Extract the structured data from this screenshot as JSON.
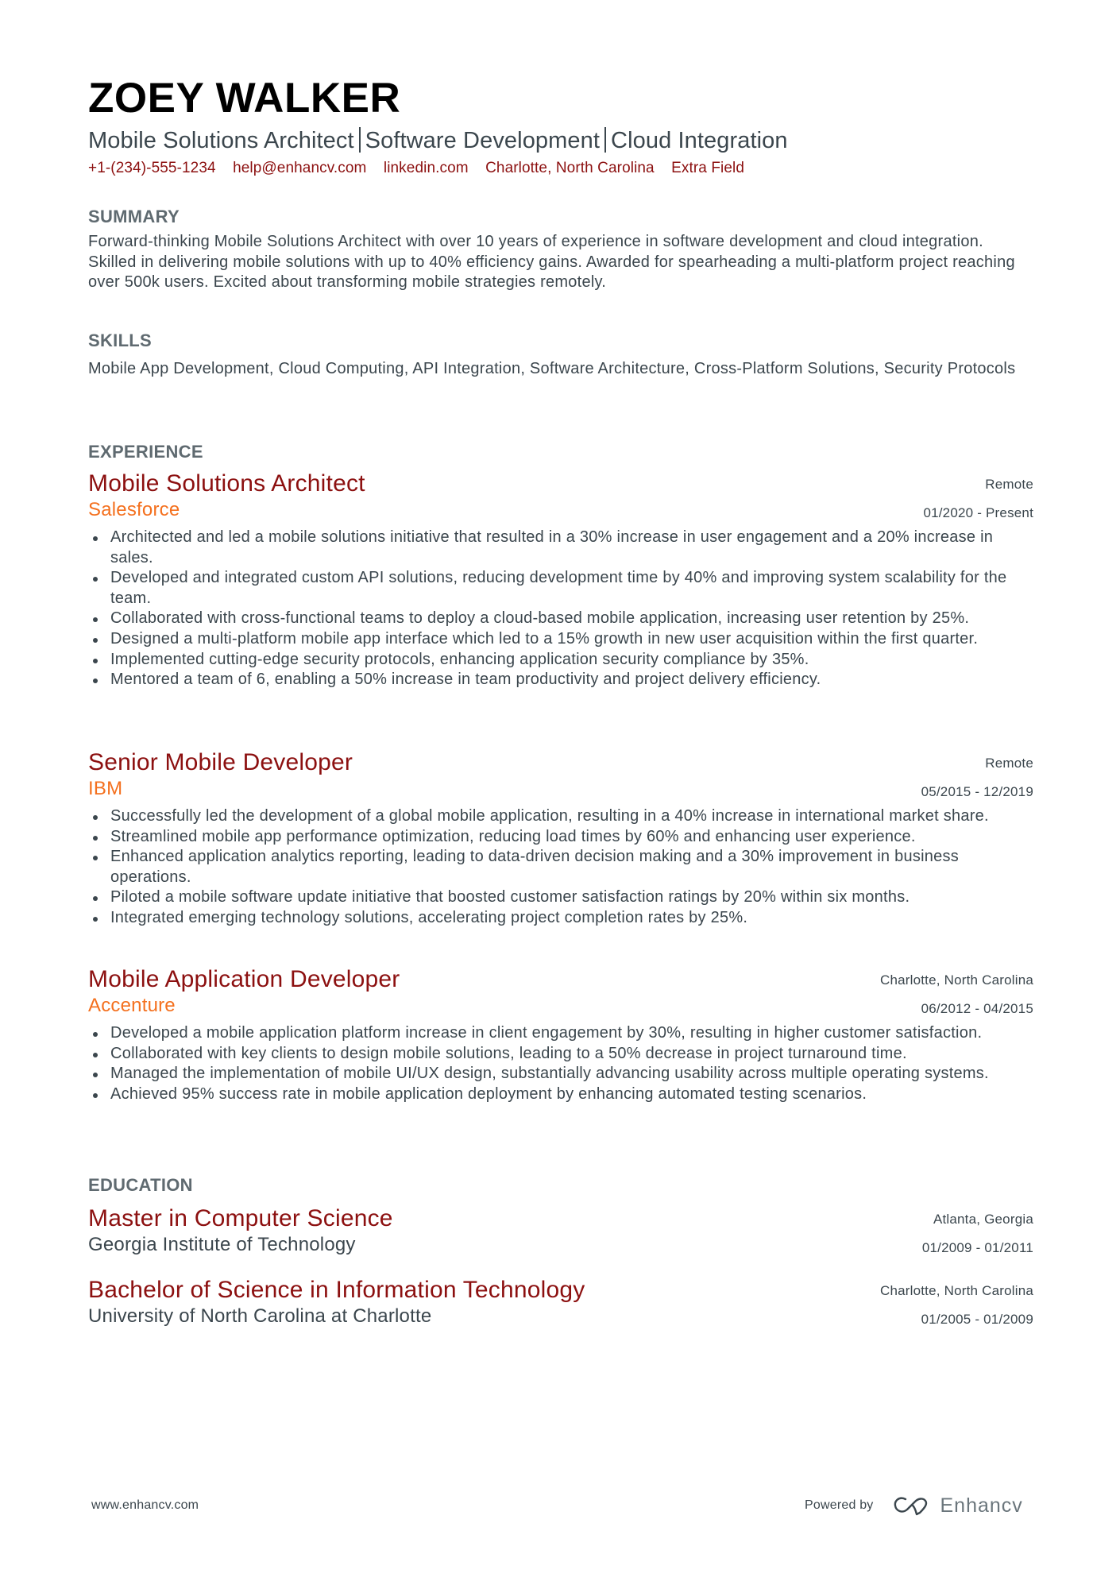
{
  "header": {
    "name": "ZOEY WALKER",
    "title_parts": [
      "Mobile Solutions Architect",
      "Software Development",
      "Cloud Integration"
    ],
    "contact": {
      "phone": "+1-(234)-555-1234",
      "email": "help@enhancv.com",
      "linkedin": "linkedin.com",
      "location": "Charlotte, North Carolina",
      "extra": "Extra Field"
    }
  },
  "summary": {
    "heading": "SUMMARY",
    "text": "Forward-thinking Mobile Solutions Architect with over 10 years of experience in software development and cloud integration. Skilled in delivering mobile solutions with up to 40% efficiency gains. Awarded for spearheading a multi-platform project reaching over 500k users. Excited about transforming mobile strategies remotely."
  },
  "skills": {
    "heading": "SKILLS",
    "text": "Mobile App Development, Cloud Computing, API Integration, Software Architecture, Cross-Platform Solutions, Security Protocols"
  },
  "experience": {
    "heading": "EXPERIENCE",
    "jobs": [
      {
        "title": "Mobile Solutions Architect",
        "company": "Salesforce",
        "location": "Remote",
        "dates": "01/2020 - Present",
        "bullets": [
          "Architected and led a mobile solutions initiative that resulted in a 30% increase in user engagement and a 20% increase in sales.",
          "Developed and integrated custom API solutions, reducing development time by 40% and improving system scalability for the team.",
          "Collaborated with cross-functional teams to deploy a cloud-based mobile application, increasing user retention by 25%.",
          "Designed a multi-platform mobile app interface which led to a 15% growth in new user acquisition within the first quarter.",
          "Implemented cutting-edge security protocols, enhancing application security compliance by 35%.",
          "Mentored a team of 6, enabling a 50% increase in team productivity and project delivery efficiency."
        ]
      },
      {
        "title": "Senior Mobile Developer",
        "company": "IBM",
        "location": "Remote",
        "dates": "05/2015 - 12/2019",
        "bullets": [
          "Successfully led the development of a global mobile application, resulting in a 40% increase in international market share.",
          "Streamlined mobile app performance optimization, reducing load times by 60% and enhancing user experience.",
          "Enhanced application analytics reporting, leading to data-driven decision making and a 30% improvement in business operations.",
          "Piloted a mobile software update initiative that boosted customer satisfaction ratings by 20% within six months.",
          "Integrated emerging technology solutions, accelerating project completion rates by 25%."
        ]
      },
      {
        "title": "Mobile Application Developer",
        "company": "Accenture",
        "location": "Charlotte, North Carolina",
        "dates": "06/2012 - 04/2015",
        "bullets": [
          "Developed a mobile application platform increase in client engagement by 30%, resulting in higher customer satisfaction.",
          "Collaborated with key clients to design mobile solutions, leading to a 50% decrease in project turnaround time.",
          "Managed the implementation of mobile UI/UX design, substantially advancing usability across multiple operating systems.",
          "Achieved 95% success rate in mobile application deployment by enhancing automated testing scenarios."
        ]
      }
    ]
  },
  "education": {
    "heading": "EDUCATION",
    "items": [
      {
        "degree": "Master in Computer Science",
        "school": "Georgia Institute of Technology",
        "location": "Atlanta, Georgia",
        "dates": "01/2009 - 01/2011"
      },
      {
        "degree": "Bachelor of Science in Information Technology",
        "school": "University of North Carolina at Charlotte",
        "location": "Charlotte, North Carolina",
        "dates": "01/2005 - 01/2009"
      }
    ]
  },
  "footer": {
    "website": "www.enhancv.com",
    "powered_by": "Powered by",
    "brand": "Enhancv",
    "brand_icon": "enhancv-logo-icon"
  },
  "colors": {
    "name": "#000000",
    "accent_title": "#8c1010",
    "accent_company": "#f4701e",
    "heading": "#5f6a70",
    "body": "#3b464d"
  }
}
